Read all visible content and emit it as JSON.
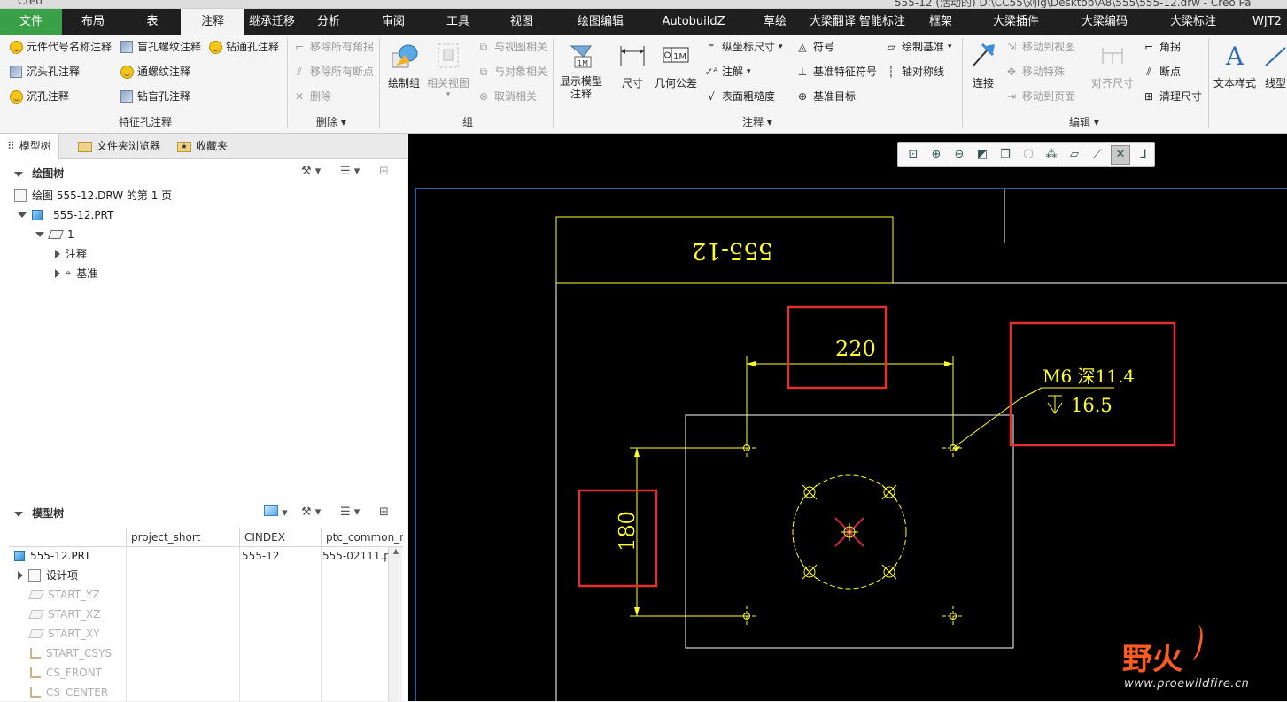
{
  "title_strip": {
    "left_text": "Creo",
    "center_text": "555-12 (活动的) D:\\CC55\\刘ig\\Desktop\\A8\\555\\555-12.drw - Creo Pa"
  },
  "menu": {
    "file": "文件",
    "items": [
      "布局",
      "表",
      "注释",
      "继承迁移",
      "分析",
      "审阅",
      "工具",
      "视图",
      "绘图编辑",
      "AutobuildZ",
      "草绘",
      "大梁翻译 智能标注",
      "框架",
      "大梁插件",
      "大梁编码",
      "大梁标注",
      "WJT2"
    ]
  },
  "ribbon": {
    "feature_hole": {
      "label": "特征孔注释",
      "buttons": [
        "元件代号名称注释",
        "盲孔螺纹注释",
        "钻通孔注释",
        "沉头孔注释",
        "通螺纹注释",
        "沉孔注释",
        "钻盲孔注释"
      ]
    },
    "delete": {
      "label": "删除",
      "buttons": [
        "移除所有角拐",
        "移除所有断点",
        "删除"
      ]
    },
    "group": {
      "label": "组",
      "big": [
        "绘制组",
        "相关视图"
      ],
      "small": [
        "与视图相关",
        "与对象相关",
        "取消相关"
      ]
    },
    "annotate": {
      "label": "注释",
      "big": [
        "显示模型注释",
        "尺寸",
        "几何公差"
      ],
      "col1": [
        "纵坐标尺寸",
        "注解",
        "表面粗糙度"
      ],
      "col2": [
        "符号",
        "基准特征符号",
        "基准目标"
      ],
      "col3": [
        "绘制基准",
        "轴对称线"
      ]
    },
    "edit": {
      "label": "编辑",
      "big": [
        "连接",
        "对齐尺寸"
      ],
      "col1": [
        "移动到视图",
        "移动特殊",
        "移动到页面"
      ],
      "col2": [
        "角拐",
        "断点",
        "清理尺寸"
      ]
    },
    "format": {
      "big": [
        "文本样式",
        "线型"
      ]
    }
  },
  "left_panel": {
    "tabs": [
      "模型树",
      "文件夹浏览器",
      "收藏夹"
    ],
    "drawing_tree": {
      "header": "绘图树",
      "rows": [
        "绘图 555-12.DRW 的第 1 页",
        "555-12.PRT",
        "1",
        "注释",
        "基准"
      ]
    },
    "model_tree": {
      "header": "模型树",
      "columns": [
        "project_short",
        "CINDEX",
        "ptc_common_n"
      ],
      "rows": [
        {
          "name": "555-12.PRT",
          "cindex": "555-12",
          "common": "555-02111.pi"
        },
        {
          "name": "设计项",
          "cindex": "",
          "common": ""
        },
        {
          "name": "START_YZ",
          "cindex": "",
          "common": ""
        },
        {
          "name": "START_XZ",
          "cindex": "",
          "common": ""
        },
        {
          "name": "START_XY",
          "cindex": "",
          "common": ""
        },
        {
          "name": "START_CSYS",
          "cindex": "",
          "common": ""
        },
        {
          "name": "CS_FRONT",
          "cindex": "",
          "common": ""
        },
        {
          "name": "CS_CENTER",
          "cindex": "",
          "common": ""
        }
      ]
    }
  },
  "drawing": {
    "title_block_text": "555-12",
    "dim_horizontal": "220",
    "dim_vertical": "180",
    "hole_note_line1": "M6 深11.4",
    "hole_note_line2": "16.5",
    "colors": {
      "background": "#000000",
      "geometry": "#ffffff",
      "annotation": "#ffff2a",
      "highlight": "#e03030",
      "frame": "#3a7fd5"
    }
  },
  "watermark": {
    "logo": "野火",
    "url": "www.proewildfire.cn"
  }
}
